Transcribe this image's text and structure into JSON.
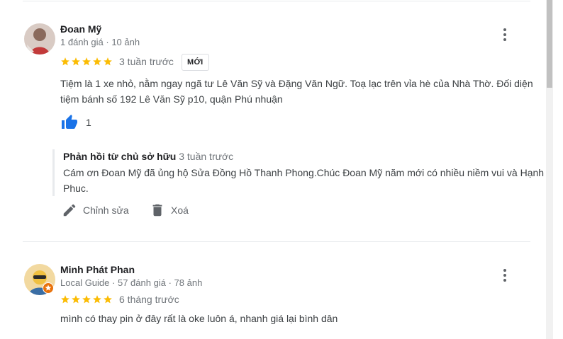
{
  "reviews": [
    {
      "reviewer_name": "Đoan Mỹ",
      "review_count": "1 đánh giá",
      "photo_count": "10 ảnh",
      "rating": 5,
      "time": "3 tuần trước",
      "badge": "MỚI",
      "text": "Tiệm là 1 xe nhỏ, nằm ngay ngã tư Lê Văn Sỹ và Đặng Văn Ngữ. Toạ lạc trên vỉa hè của Nhà Thờ. Đối diện tiệm bánh số 192 Lê Văn Sỹ p10, quận Phú nhuận",
      "likes": "1",
      "owner_reply": {
        "label": "Phản hồi từ chủ sở hữu",
        "time": "3 tuần trước",
        "text": "Cám ơn Đoan Mỹ đã ủng hộ Sửa Đồng Hồ Thanh Phong.Chúc Đoan Mỹ năm mới có nhiều niềm vui và Hạnh Phuc."
      },
      "actions": {
        "edit_label": "Chỉnh sửa",
        "delete_label": "Xoá"
      }
    },
    {
      "reviewer_name": "Minh Phát Phan",
      "local_guide": "Local Guide",
      "review_count": "57 đánh giá",
      "photo_count": "78 ảnh",
      "rating": 5,
      "time": "6 tháng trước",
      "text": "mình có thay pin ở đây rất là oke luôn á, nhanh giá lại bình dân"
    }
  ],
  "meta_separator": "·",
  "colors": {
    "star": "#fbbc04",
    "like": "#1a73e8",
    "text_secondary": "#70757a",
    "local_guide_badge": "#e8710a"
  }
}
